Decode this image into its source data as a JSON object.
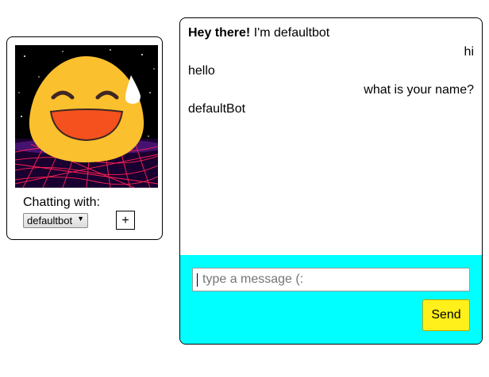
{
  "sidebar": {
    "chatting_label": "Chatting with:",
    "selected_bot": "defaultbot",
    "add_label": "+"
  },
  "chat": {
    "greeting_bold": "Hey there!",
    "greeting_rest": " I'm defaultbot",
    "messages": [
      {
        "from": "user",
        "text": "hi"
      },
      {
        "from": "bot",
        "text": "hello"
      },
      {
        "from": "user",
        "text": "what is your name?"
      },
      {
        "from": "bot",
        "text": "defaultBot"
      }
    ]
  },
  "composer": {
    "placeholder": "type a message (:",
    "value": "",
    "send_label": "Send"
  },
  "colors": {
    "composer_bg": "#00ffff",
    "send_bg": "#ffef1a"
  }
}
